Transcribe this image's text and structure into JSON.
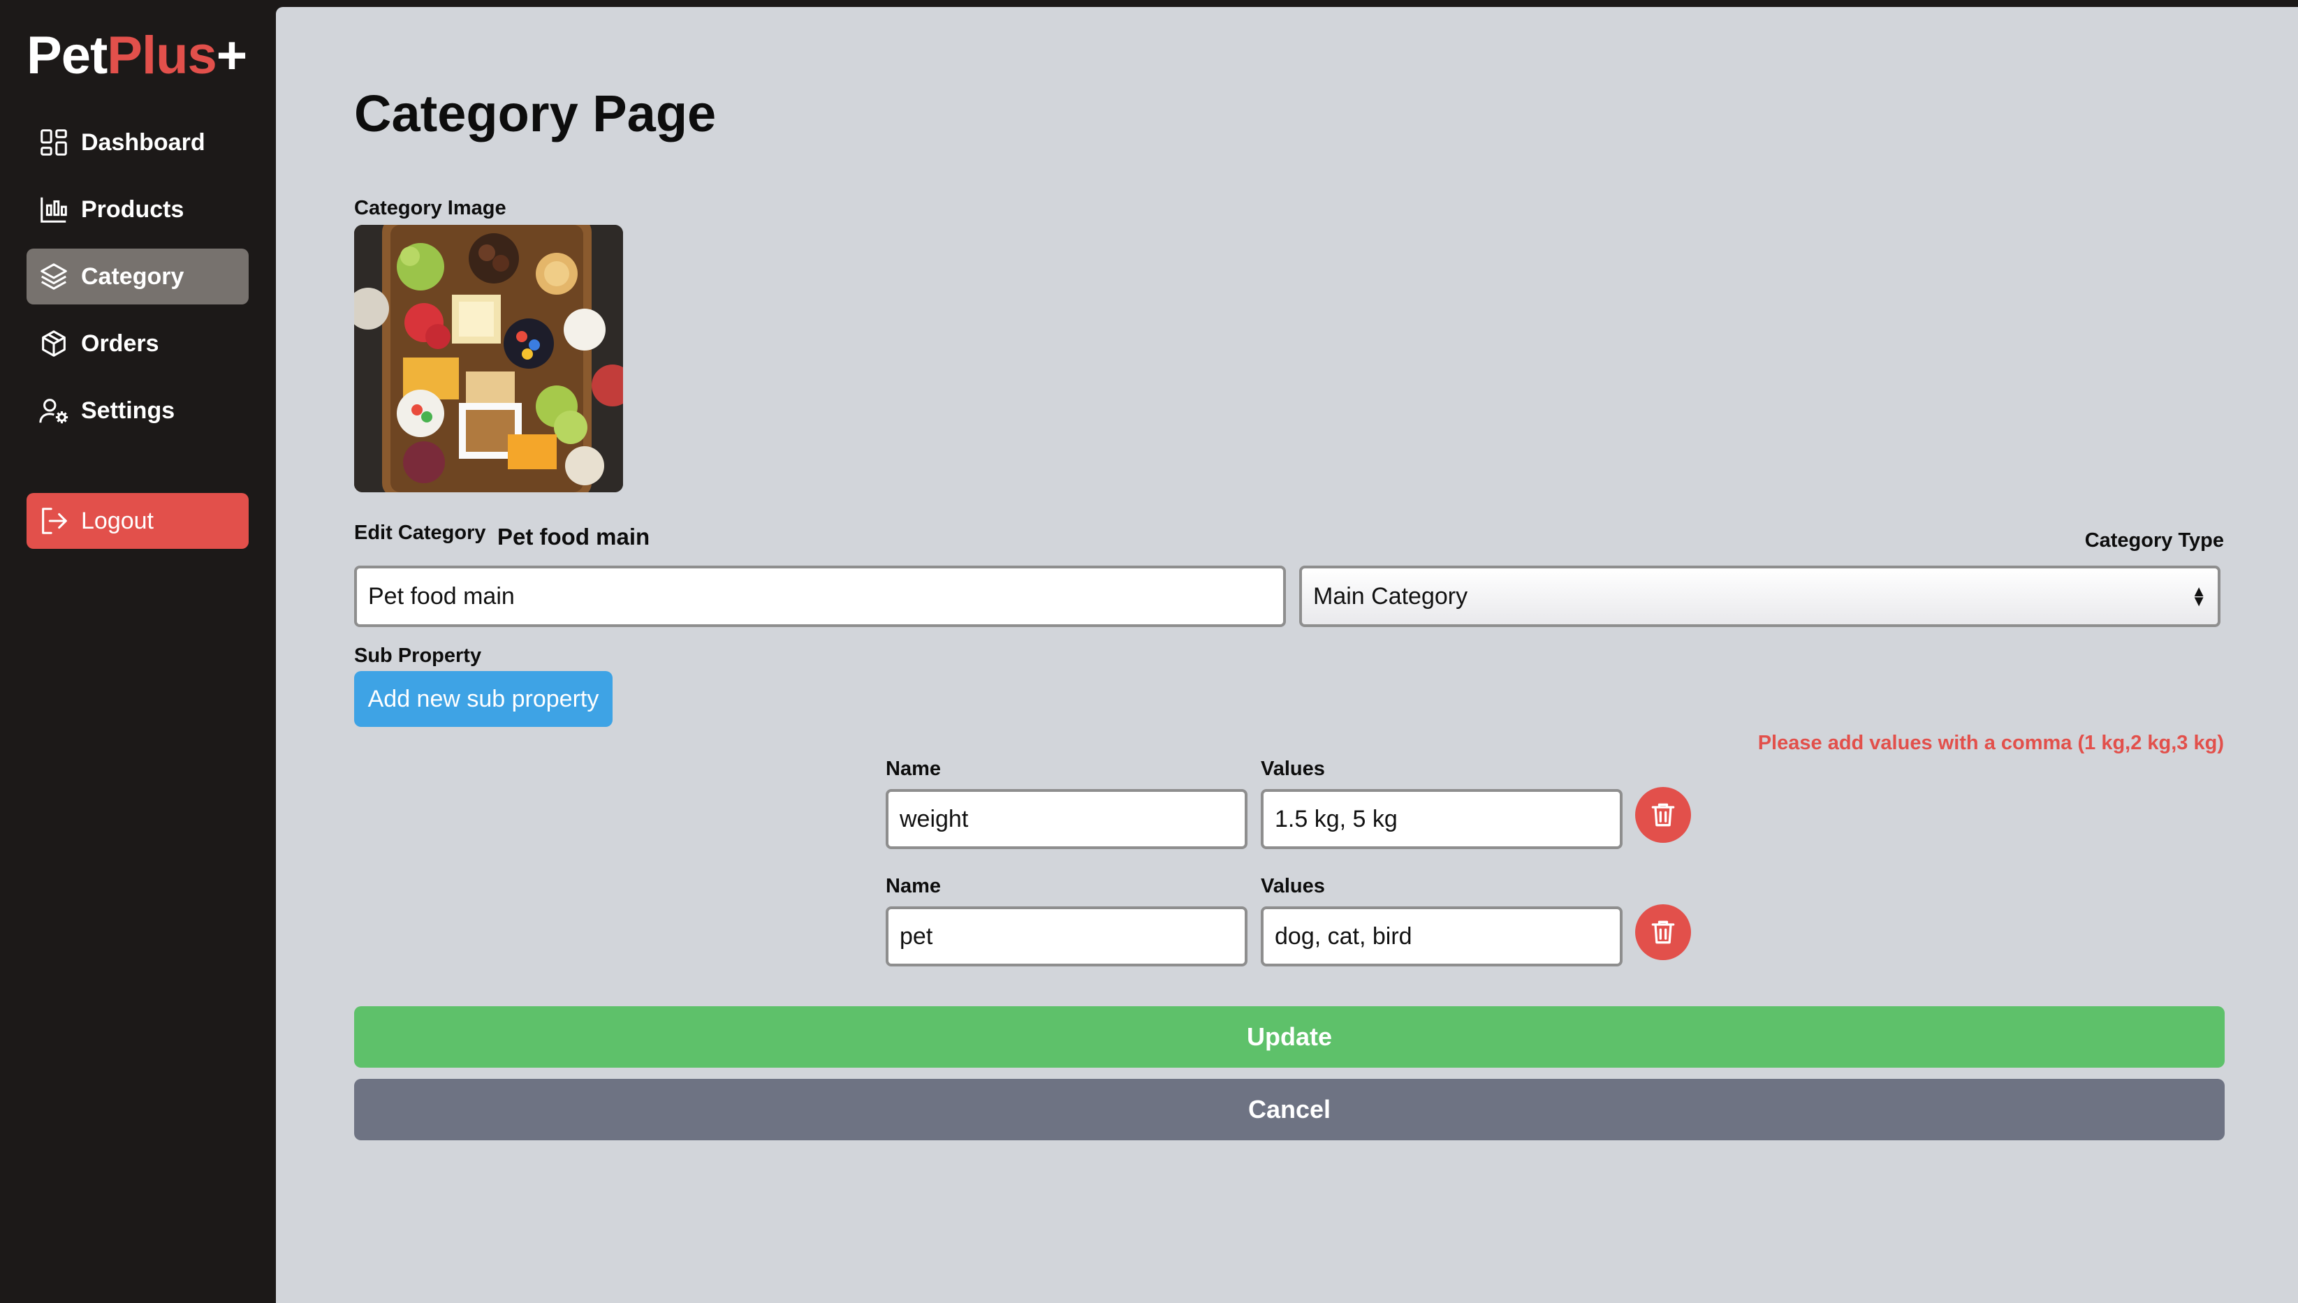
{
  "brand": {
    "part1": "Pet",
    "part2": "Plus",
    "part3": "+",
    "accent": "#e2504b"
  },
  "sidebar": {
    "items": [
      {
        "label": "Dashboard",
        "icon": "dashboard-icon"
      },
      {
        "label": "Products",
        "icon": "chart-icon"
      },
      {
        "label": "Category",
        "icon": "layers-icon",
        "active": true
      },
      {
        "label": "Orders",
        "icon": "box-icon"
      },
      {
        "label": "Settings",
        "icon": "user-settings-icon"
      }
    ],
    "logout_label": "Logout"
  },
  "main": {
    "title": "Category Page",
    "category_image_label": "Category Image",
    "edit_category_label": "Edit Category",
    "edit_category_value": "Pet food main",
    "category_name_input": "Pet food main",
    "category_type_label": "Category Type",
    "category_type_selected": "Main Category",
    "sub_property_label": "Sub Property",
    "add_sub_property_label": "Add new sub property",
    "hint": "Please add values with a comma (1 kg,2 kg,3 kg)",
    "sub_properties": [
      {
        "name_label": "Name",
        "values_label": "Values",
        "name": "weight",
        "values": "1.5 kg, 5 kg"
      },
      {
        "name_label": "Name",
        "values_label": "Values",
        "name": "pet",
        "values": "dog, cat, bird"
      }
    ],
    "update_label": "Update",
    "cancel_label": "Cancel"
  }
}
